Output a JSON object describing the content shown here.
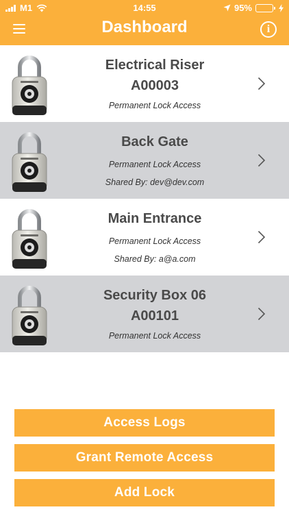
{
  "status_bar": {
    "carrier": "M1",
    "time": "14:55",
    "battery_percent": "95%",
    "battery_level": 0.95,
    "icons": [
      "signal-icon",
      "wifi-icon",
      "location-arrow-icon",
      "battery-icon",
      "charging-bolt-icon"
    ]
  },
  "header": {
    "title": "Dashboard",
    "menu_icon": "hamburger-menu-icon",
    "info_icon": "info-icon",
    "info_glyph": "i"
  },
  "locks": [
    {
      "name": "Electrical Riser",
      "code": "A00003",
      "access": "Permanent Lock Access",
      "shared_by": ""
    },
    {
      "name": "Back Gate",
      "code": "",
      "access": "Permanent Lock Access",
      "shared_by": "Shared By: dev@dev.com"
    },
    {
      "name": "Main Entrance",
      "code": "",
      "access": "Permanent Lock Access",
      "shared_by": "Shared By: a@a.com"
    },
    {
      "name": "Security Box 06",
      "code": "A00101",
      "access": "Permanent Lock Access",
      "shared_by": ""
    }
  ],
  "actions": {
    "access_logs": "Access Logs",
    "grant_remote_access": "Grant Remote Access",
    "add_lock": "Add Lock"
  },
  "colors": {
    "accent": "#fbb03b",
    "row_alt": "#d2d3d6",
    "text_dark": "#4a4a4a"
  }
}
